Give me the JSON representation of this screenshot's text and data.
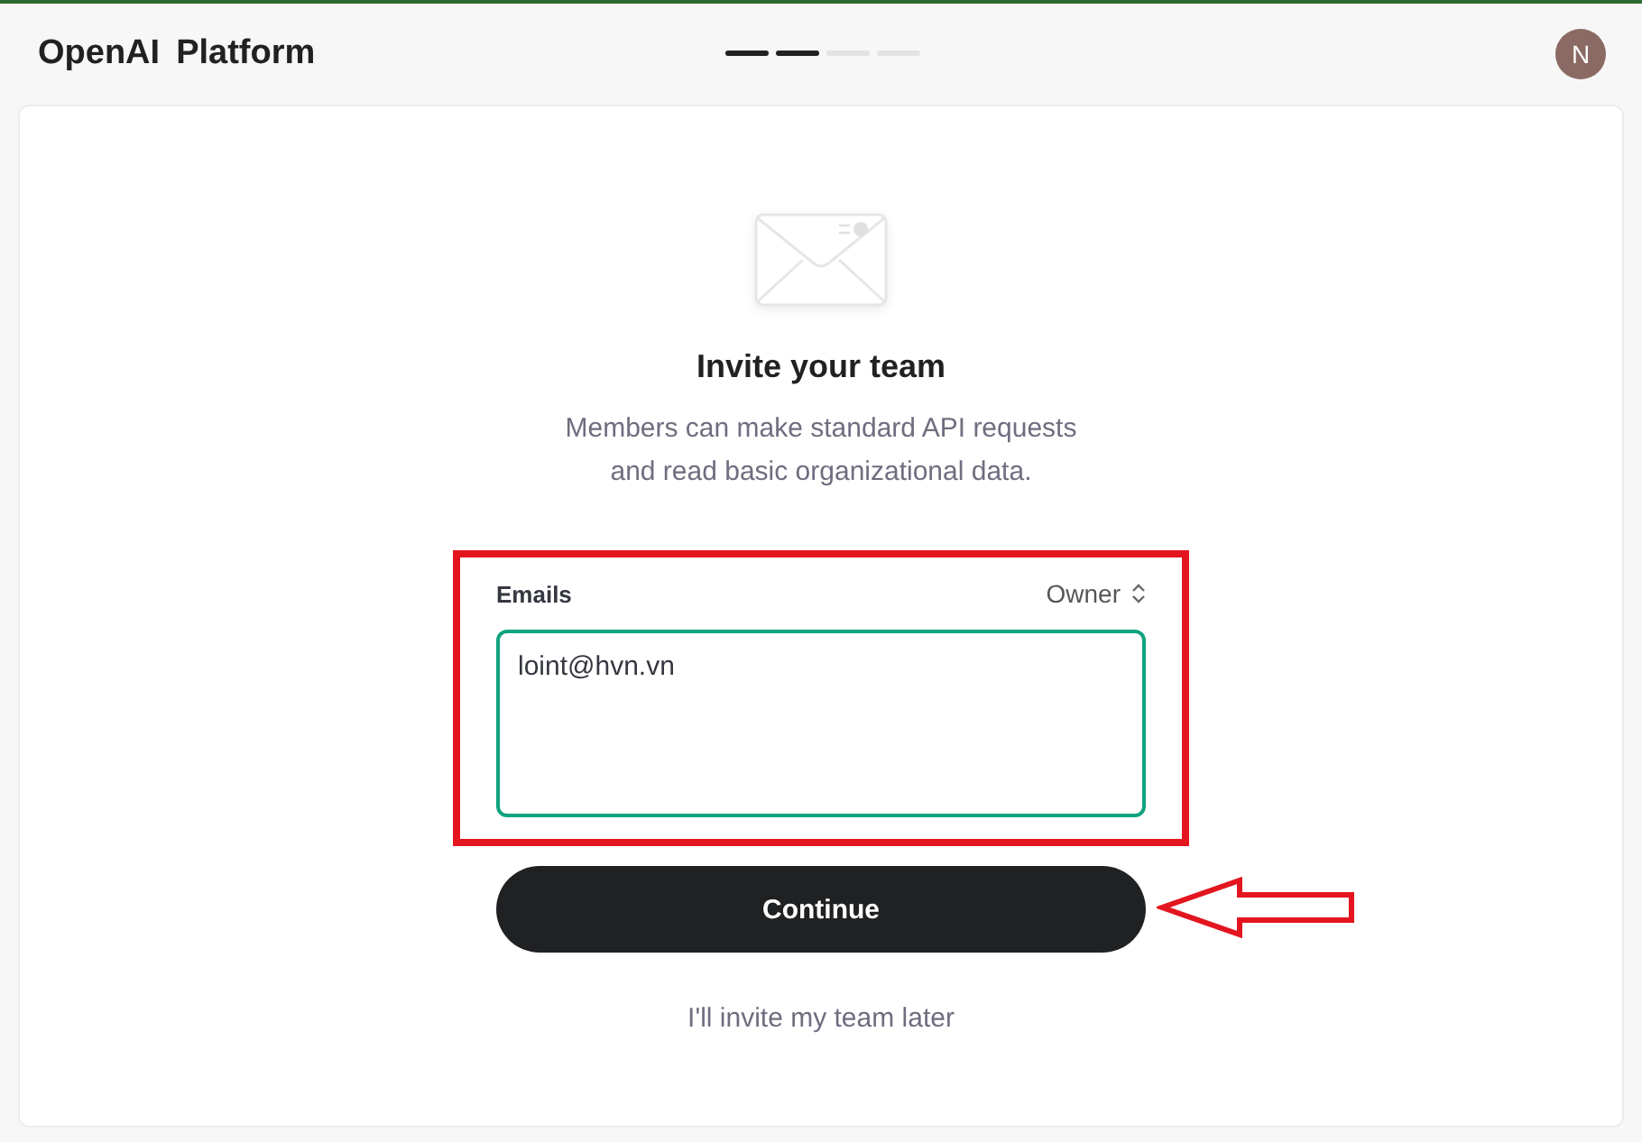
{
  "header": {
    "brand": [
      "OpenAI",
      "Platform"
    ],
    "steps": [
      {
        "done": true
      },
      {
        "done": true
      },
      {
        "done": false
      },
      {
        "done": false
      }
    ],
    "avatar": "N"
  },
  "invite": {
    "title": "Invite your team",
    "description": [
      "Members can make standard API requests",
      "and read basic organizational data."
    ],
    "emails_label": "Emails",
    "role": "Owner",
    "emails_value": "loint@hvn.vn",
    "continue": "Continue",
    "later_link": "I'll invite my team later"
  },
  "annotations": {
    "frame": true,
    "arrow": true
  }
}
